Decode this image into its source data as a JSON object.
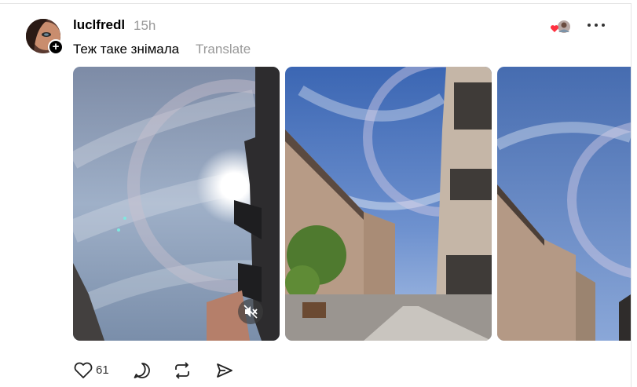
{
  "post": {
    "username": "luclfredl",
    "time": "15h",
    "text": "Теж таке знімала",
    "translate_label": "Translate"
  },
  "actions": {
    "like_count": "61"
  },
  "icons": {
    "follow": "plus-icon",
    "reaction": "heart-icon",
    "more": "more-icon",
    "like": "heart-icon",
    "comment": "comment-icon",
    "repost": "repost-icon",
    "share": "share-icon",
    "video": "mute-icon"
  },
  "colors": {
    "heart": "#ff3040",
    "secondary_text": "#999999"
  }
}
